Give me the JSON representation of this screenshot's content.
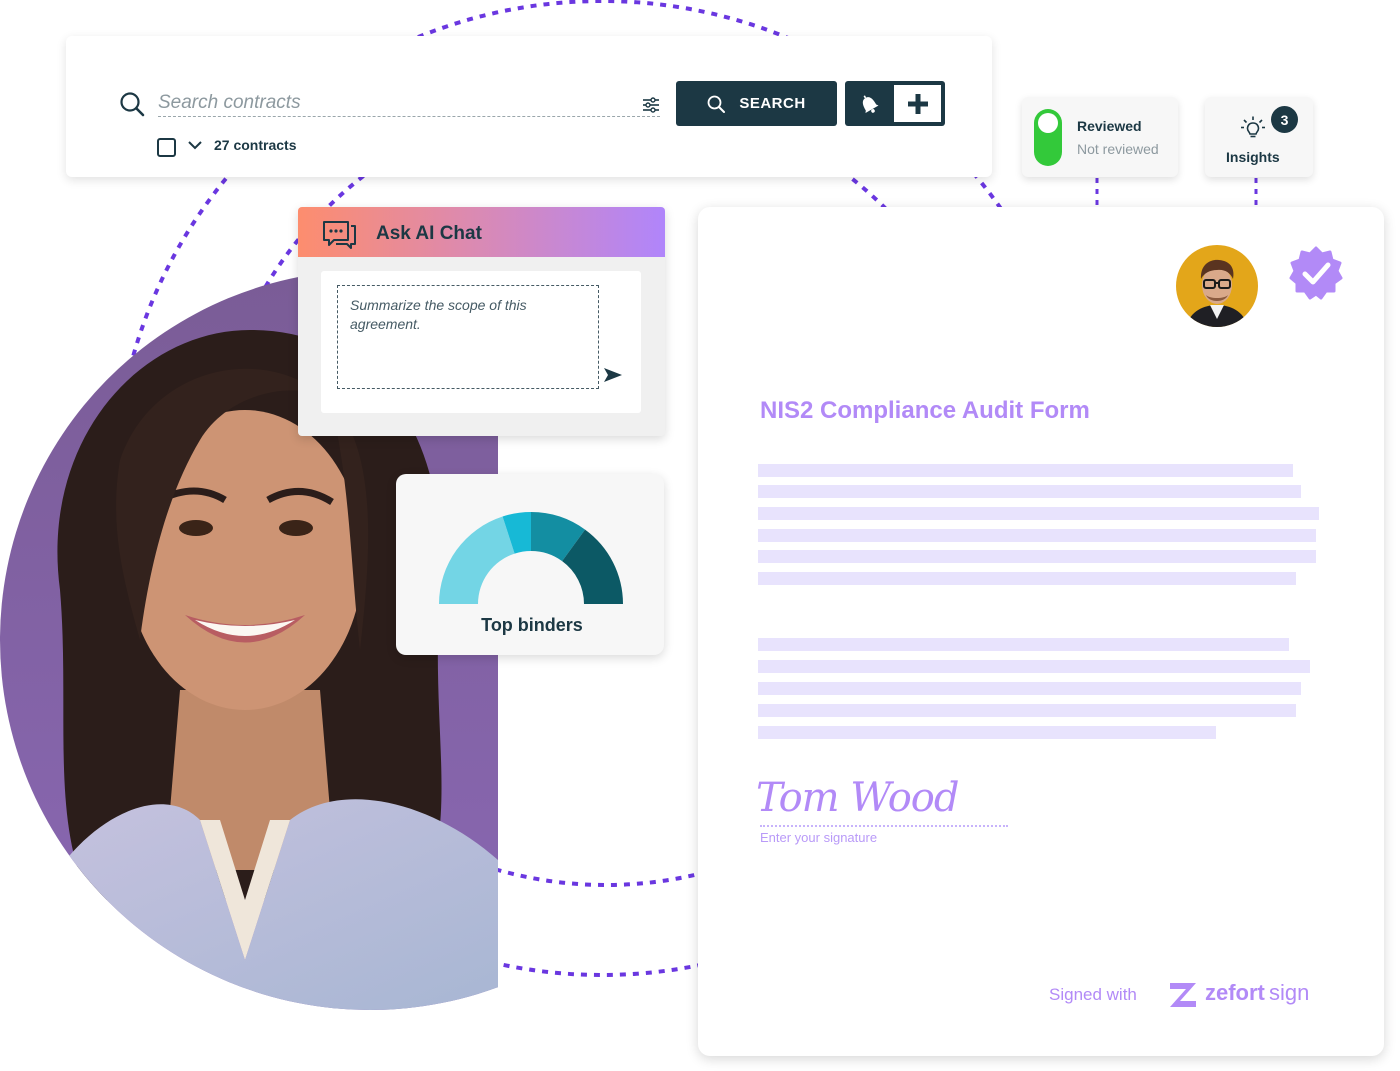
{
  "search": {
    "placeholder": "Search contracts",
    "button_label": "SEARCH",
    "contract_count": "27 contracts",
    "icons": {
      "search": "search-icon",
      "filter": "sliders-icon",
      "bell": "bell-icon",
      "plus": "plus-icon",
      "chevron": "chevron-down-icon"
    }
  },
  "review_toggle": {
    "on_label": "Reviewed",
    "off_label": "Not reviewed",
    "state": "reviewed",
    "color": "#33c93a"
  },
  "insights": {
    "label": "Insights",
    "count": "3",
    "icon": "lightbulb-icon"
  },
  "ai_chat": {
    "title": "Ask AI Chat",
    "prompt_text": "Summarize the scope of this agreement.",
    "icon": "chat-bubbles-icon",
    "send_icon": "send-arrow-icon"
  },
  "top_binders": {
    "label": "Top binders",
    "chart_data": {
      "type": "pie",
      "subtype": "half-donut",
      "title": "Top binders",
      "values": [
        40,
        10,
        20,
        30
      ],
      "colors": [
        "#73d5e5",
        "#17b9d6",
        "#138ea2",
        "#0c5965"
      ]
    }
  },
  "document": {
    "title": "NIS2 Compliance Audit Form",
    "signature_name": "Tom Wood",
    "signature_hint": "Enter your signature",
    "signed_with": "Signed with",
    "brand_bold": "zefort",
    "brand_light": "sign",
    "verified_icon": "verified-badge-icon",
    "accent_color": "#b28af7"
  },
  "colors": {
    "primary_dark": "#1c3844",
    "accent_purple": "#b28af7",
    "dotted_ring": "#6a37e0"
  }
}
